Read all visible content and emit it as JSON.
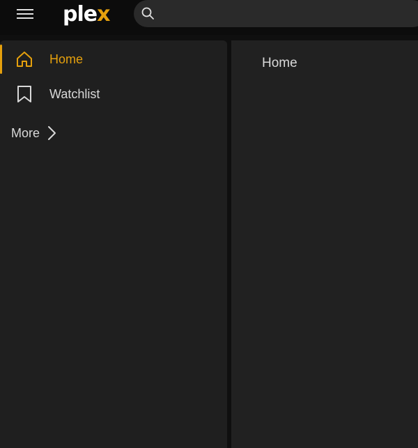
{
  "topbar": {
    "logo_main": "ple",
    "logo_accent": "x",
    "search": {
      "value": "",
      "placeholder": ""
    }
  },
  "sidebar": {
    "items": [
      {
        "label": "Home",
        "icon": "home-icon",
        "active": true
      },
      {
        "label": "Watchlist",
        "icon": "bookmark-icon",
        "active": false
      }
    ],
    "more_label": "More"
  },
  "main": {
    "title": "Home"
  },
  "colors": {
    "accent": "#e5a00d",
    "background": "#0f0f0f",
    "panel": "#1f1f1f",
    "text": "#d9d9d9"
  }
}
